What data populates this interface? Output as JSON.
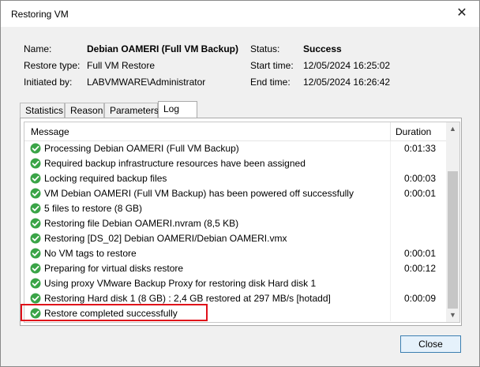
{
  "window": {
    "title": "Restoring VM",
    "close_icon": "close-icon"
  },
  "info": {
    "name_label": "Name:",
    "name_value": "Debian OAMERI (Full VM Backup)",
    "restore_type_label": "Restore type:",
    "restore_type_value": "Full VM Restore",
    "initiated_by_label": "Initiated by:",
    "initiated_by_value": "LABVMWARE\\Administrator",
    "status_label": "Status:",
    "status_value": "Success",
    "start_time_label": "Start time:",
    "start_time_value": "12/05/2024 16:25:02",
    "end_time_label": "End time:",
    "end_time_value": "12/05/2024 16:26:42"
  },
  "tabs": [
    {
      "label": "Statistics"
    },
    {
      "label": "Reason"
    },
    {
      "label": "Parameters"
    },
    {
      "label": "Log",
      "active": true
    }
  ],
  "log": {
    "columns": {
      "message": "Message",
      "duration": "Duration"
    },
    "rows": [
      {
        "message": "Processing Debian OAMERI (Full VM Backup)",
        "duration": "0:01:33"
      },
      {
        "message": "Required backup infrastructure resources have been assigned",
        "duration": ""
      },
      {
        "message": "Locking required backup files",
        "duration": "0:00:03"
      },
      {
        "message": "VM Debian OAMERI (Full VM Backup) has been powered off successfully",
        "duration": "0:00:01"
      },
      {
        "message": "5 files to restore (8 GB)",
        "duration": ""
      },
      {
        "message": "Restoring file Debian OAMERI.nvram (8,5 KB)",
        "duration": ""
      },
      {
        "message": "Restoring [DS_02] Debian OAMERI/Debian OAMERI.vmx",
        "duration": ""
      },
      {
        "message": "No VM tags to restore",
        "duration": "0:00:01"
      },
      {
        "message": "Preparing for virtual disks restore",
        "duration": "0:00:12"
      },
      {
        "message": "Using proxy VMware Backup Proxy for restoring disk Hard disk 1",
        "duration": ""
      },
      {
        "message": "Restoring Hard disk 1 (8 GB) : 2,4 GB restored at 297 MB/s  [hotadd]",
        "duration": "0:00:09"
      },
      {
        "message": "Restore completed successfully",
        "duration": ""
      }
    ],
    "status_icon": "success-check-icon",
    "success_color": "#3aa447"
  },
  "buttons": {
    "close_label": "Close"
  },
  "colors": {
    "highlight": "#e0101a",
    "button_border": "#3c7fb1"
  }
}
